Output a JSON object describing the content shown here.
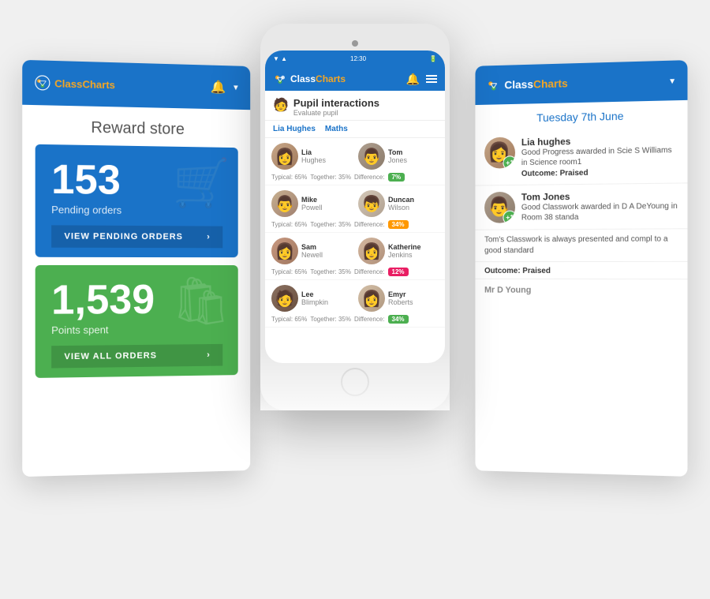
{
  "left_tablet": {
    "app_name": "ClassCharts",
    "reward_store_title": "Reward store",
    "pending_count": "153",
    "pending_label": "Pending orders",
    "pending_btn": "VIEW PENDING ORDERS",
    "spent_count": "1,539",
    "spent_label": "Points spent",
    "spent_btn": "VIEW ALL ORDERS"
  },
  "center_phone": {
    "app_name": "Class",
    "app_name2": "Charts",
    "time": "12:30",
    "section_title": "Pupil interactions",
    "section_subtitle": "Evaluate pupil",
    "tab1": "Lia Hughes",
    "tab2": "Maths",
    "pairs": [
      {
        "p1_first": "Lia",
        "p1_last": "Hughes",
        "p2_first": "Tom",
        "p2_last": "Jones",
        "typical": "65%",
        "together": "35%",
        "difference": "7%",
        "diff_class": "diff-green"
      },
      {
        "p1_first": "Mike",
        "p1_last": "Powell",
        "p2_first": "Duncan",
        "p2_last": "Wilson",
        "typical": "65%",
        "together": "35%",
        "difference": "34%",
        "diff_class": "diff-orange"
      },
      {
        "p1_first": "Sam",
        "p1_last": "Newell",
        "p2_first": "Katherine",
        "p2_last": "Jenkins",
        "typical": "65%",
        "together": "35%",
        "difference": "12%",
        "diff_class": "diff-pink"
      },
      {
        "p1_first": "Lee",
        "p1_last": "Blimpkin",
        "p2_first": "Emyr",
        "p2_last": "Roberts",
        "typical": "65%",
        "together": "35%",
        "difference": "34%",
        "diff_class": "diff-green"
      }
    ],
    "stats_typical": "Typical: 65%",
    "stats_together": "Together: 35%",
    "stats_diff": "Difference:"
  },
  "right_tablet": {
    "app_name": "ClassCharts",
    "date": "Tuesday 7th June",
    "activities": [
      {
        "name": "Lia hughes",
        "badge": "+1",
        "desc": "Good Progress awarded in Scie S Williams in Science room1",
        "outcome_label": "Outcome:",
        "outcome": "Praised"
      },
      {
        "name": "Tom Jones",
        "badge": "+1",
        "desc": "Good Classwork awarded in D A DeYoung in Room 38 standa",
        "comment": "Tom's Classwork is always presented and compl to a good standard",
        "outcome_label": "Outcome:",
        "outcome": "Praised"
      }
    ],
    "teacher": "Mr D Young"
  }
}
